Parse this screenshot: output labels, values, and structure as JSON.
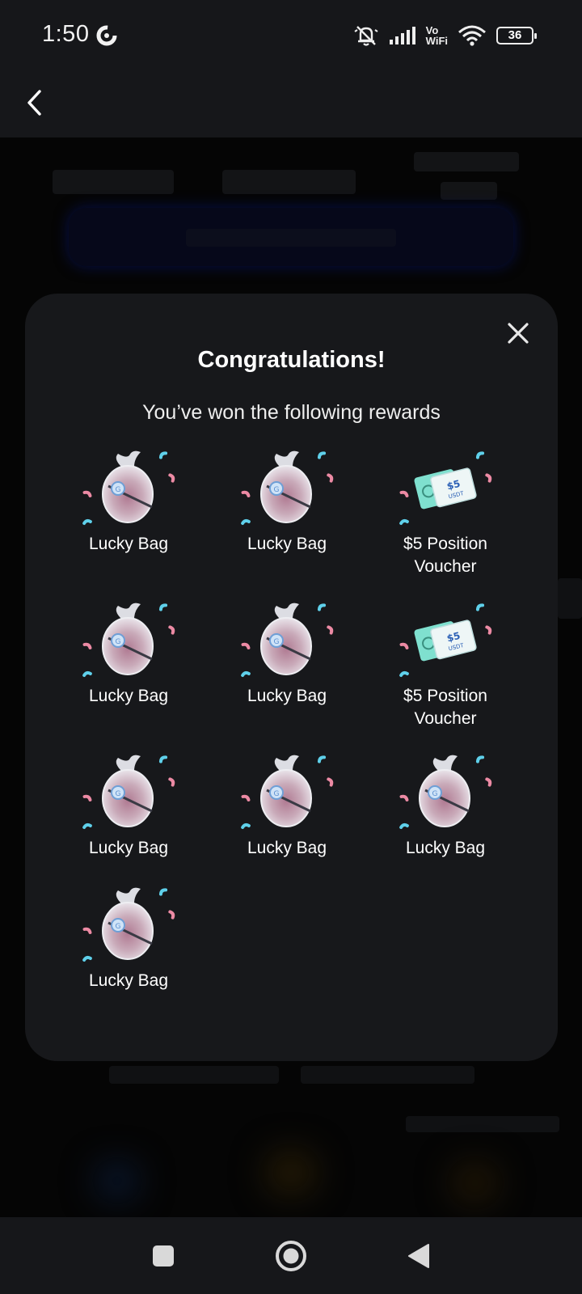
{
  "status_bar": {
    "time": "1:50",
    "vowifi_top": "Vo",
    "vowifi_bottom": "WiFi",
    "battery": "36"
  },
  "header": {
    "back_icon": "chevron-left-icon"
  },
  "modal": {
    "title": "Congratulations!",
    "subtitle": "You’ve won the following rewards",
    "close_icon": "close-icon",
    "rewards": [
      {
        "label": "Lucky Bag",
        "icon": "lucky-bag-icon"
      },
      {
        "label": "Lucky Bag",
        "icon": "lucky-bag-icon"
      },
      {
        "label": "$5 Position Voucher",
        "icon": "voucher-icon",
        "voucher_amount": "$5",
        "voucher_unit": "USDT"
      },
      {
        "label": "Lucky Bag",
        "icon": "lucky-bag-icon"
      },
      {
        "label": "Lucky Bag",
        "icon": "lucky-bag-icon"
      },
      {
        "label": "$5 Position Voucher",
        "icon": "voucher-icon",
        "voucher_amount": "$5",
        "voucher_unit": "USDT"
      },
      {
        "label": "Lucky Bag",
        "icon": "lucky-bag-icon"
      },
      {
        "label": "Lucky Bag",
        "icon": "lucky-bag-icon"
      },
      {
        "label": "Lucky Bag",
        "icon": "lucky-bag-icon"
      },
      {
        "label": "Lucky Bag",
        "icon": "lucky-bag-icon"
      }
    ]
  },
  "nav_bar": {
    "recents_icon": "square-icon",
    "home_icon": "circle-home-icon",
    "back_icon": "triangle-back-icon"
  },
  "colors": {
    "modal_bg": "#17181b",
    "page_bg": "#050505",
    "bars_bg": "#16171a",
    "confetti_blue": "#5fd0ea",
    "confetti_pink": "#ec8aa4",
    "voucher_teal": "#7fe0cf"
  }
}
